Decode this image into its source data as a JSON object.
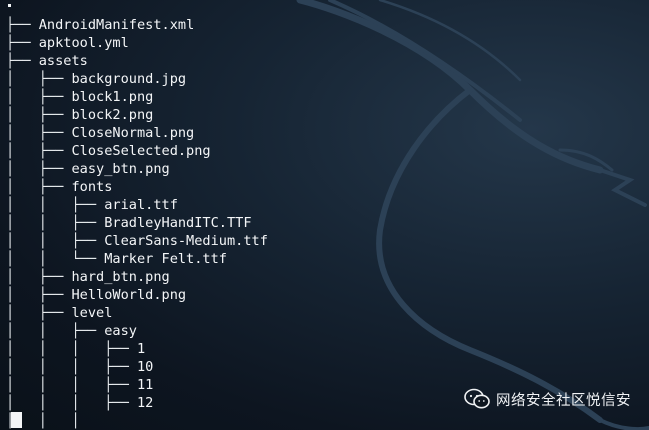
{
  "terminal": {
    "lines": [
      {
        "prefix": "├── ",
        "name": "AndroidManifest.xml"
      },
      {
        "prefix": "├── ",
        "name": "apktool.yml"
      },
      {
        "prefix": "├── ",
        "name": "assets"
      },
      {
        "prefix": "│   ├── ",
        "name": "background.jpg"
      },
      {
        "prefix": "│   ├── ",
        "name": "block1.png"
      },
      {
        "prefix": "│   ├── ",
        "name": "block2.png"
      },
      {
        "prefix": "│   ├── ",
        "name": "CloseNormal.png"
      },
      {
        "prefix": "│   ├── ",
        "name": "CloseSelected.png"
      },
      {
        "prefix": "│   ├── ",
        "name": "easy_btn.png"
      },
      {
        "prefix": "│   ├── ",
        "name": "fonts"
      },
      {
        "prefix": "│   │   ├── ",
        "name": "arial.ttf"
      },
      {
        "prefix": "│   │   ├── ",
        "name": "BradleyHandITC.TTF"
      },
      {
        "prefix": "│   │   ├── ",
        "name": "ClearSans-Medium.ttf"
      },
      {
        "prefix": "│   │   └── ",
        "name": "Marker Felt.ttf"
      },
      {
        "prefix": "│   ├── ",
        "name": "hard_btn.png"
      },
      {
        "prefix": "│   ├── ",
        "name": "HelloWorld.png"
      },
      {
        "prefix": "│   ├── ",
        "name": "level"
      },
      {
        "prefix": "│   │   ├── ",
        "name": "easy"
      },
      {
        "prefix": "│   │   │   ├── ",
        "name": "1"
      },
      {
        "prefix": "│   │   │   ├── ",
        "name": "10"
      },
      {
        "prefix": "│   │   │   ├── ",
        "name": "11"
      },
      {
        "prefix": "│   │   │   ├── ",
        "name": "12"
      },
      {
        "prefix": "│   │   │",
        "name": ""
      }
    ]
  },
  "watermark": {
    "icon": "wechat-icon",
    "text": "网络安全社区悦信安"
  },
  "colors": {
    "background": "#0e1620",
    "text": "#f4f6f8"
  }
}
